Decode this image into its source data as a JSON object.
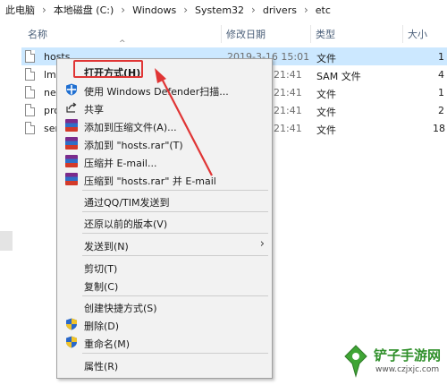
{
  "breadcrumb": [
    "此电脑",
    "本地磁盘 (C:)",
    "Windows",
    "System32",
    "drivers",
    "etc"
  ],
  "columns": {
    "name": "名称",
    "date": "修改日期",
    "type": "类型",
    "size": "大小"
  },
  "files": [
    {
      "name": "hosts",
      "date": "2019-3-16 15:01",
      "type": "文件",
      "size": "1"
    },
    {
      "name": "lmh",
      "date": "21:41",
      "type": "SAM 文件",
      "size": "4"
    },
    {
      "name": "net",
      "date": "21:41",
      "type": "文件",
      "size": "1"
    },
    {
      "name": "pro",
      "date": "21:41",
      "type": "文件",
      "size": "2"
    },
    {
      "name": "ser",
      "date": "21:41",
      "type": "文件",
      "size": "18"
    }
  ],
  "menu": {
    "open_with": "打开方式(H)",
    "defender": "使用 Windows Defender扫描...",
    "share": "共享",
    "add_archive": "添加到压缩文件(A)...",
    "add_rar": "添加到 \"hosts.rar\"(T)",
    "compress_email": "压缩并 E-mail...",
    "compress_rar_email": "压缩到 \"hosts.rar\" 并 E-mail",
    "qq_send": "通过QQ/TIM发送到",
    "restore": "还原以前的版本(V)",
    "send_to": "发送到(N)",
    "cut": "剪切(T)",
    "copy": "复制(C)",
    "create_shortcut": "创建快捷方式(S)",
    "delete": "删除(D)",
    "rename": "重命名(M)",
    "properties": "属性(R)"
  },
  "watermark": {
    "brand": "铲子手游网",
    "url": "www.czjxjc.com"
  },
  "colors": {
    "selection": "#cce8ff",
    "highlight": "#e03535",
    "menu_bg": "#f2f2f2"
  }
}
